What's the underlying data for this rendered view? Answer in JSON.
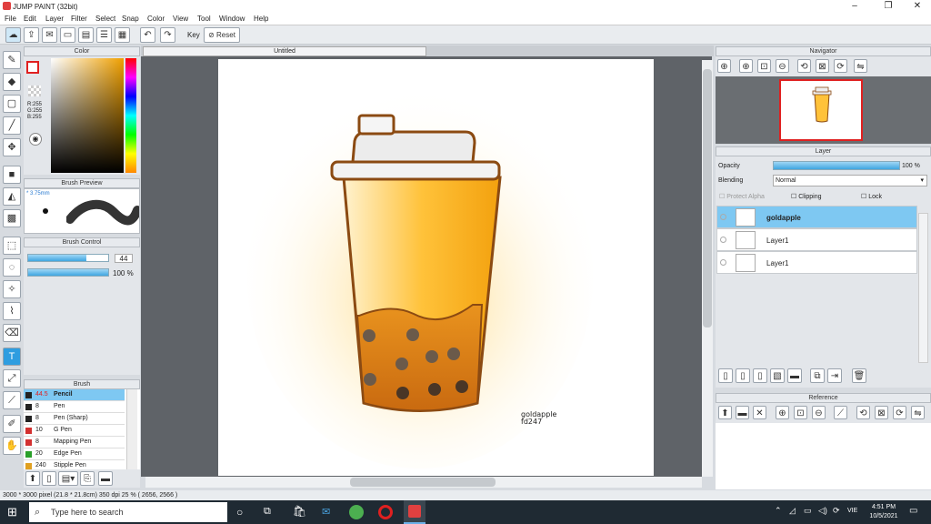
{
  "window": {
    "title": "JUMP PAINT (32bit)",
    "controls": {
      "minimize": "–",
      "maximize": "❐",
      "close": "✕"
    }
  },
  "menubar": [
    "File",
    "Edit",
    "Layer",
    "Filter",
    "Select",
    "Snap",
    "Color",
    "View",
    "Tool",
    "Window",
    "Help"
  ],
  "toolbar": {
    "key_label": "Key",
    "reset_label": "Reset"
  },
  "color_panel": {
    "title": "Color",
    "r": "R:255",
    "g": "G:255",
    "b": "B:255"
  },
  "brush_preview": {
    "title": "Brush Preview",
    "size": "* 3.75mm"
  },
  "brush_control": {
    "title": "Brush Control",
    "size_value": "44",
    "opacity_value": "100 %",
    "size_fraction": 0.73,
    "opacity_fraction": 1.0
  },
  "brush_panel": {
    "title": "Brush",
    "items": [
      {
        "size": "44.5",
        "name": "Pencil",
        "color": "#222222",
        "selected": true
      },
      {
        "size": "8",
        "name": "Pen",
        "color": "#222222",
        "selected": false
      },
      {
        "size": "8",
        "name": "Pen (Sharp)",
        "color": "#222222",
        "selected": false
      },
      {
        "size": "10",
        "name": "G Pen",
        "color": "#d33030",
        "selected": false
      },
      {
        "size": "8",
        "name": "Mapping Pen",
        "color": "#d33030",
        "selected": false
      },
      {
        "size": "20",
        "name": "Edge Pen",
        "color": "#2aa02a",
        "selected": false
      },
      {
        "size": "240",
        "name": "Stipple Pen",
        "color": "#e0a020",
        "selected": false
      }
    ]
  },
  "document": {
    "tab_title": "Untitled",
    "signature_line1": "goldapple",
    "signature_line2": "fd247"
  },
  "navigator": {
    "title": "Navigator"
  },
  "layer_panel": {
    "title": "Layer",
    "opacity_label": "Opacity",
    "opacity_value": "100 %",
    "blending_label": "Blending",
    "blending_value": "Normal",
    "protect_alpha": "Protect Alpha",
    "clipping": "Clipping",
    "lock": "Lock",
    "layers": [
      {
        "name": "goldapple",
        "selected": true
      },
      {
        "name": "Layer1",
        "selected": false
      },
      {
        "name": "Layer1",
        "selected": false
      }
    ]
  },
  "reference": {
    "title": "Reference"
  },
  "status": "3000 * 3000 pixel  (21.8 * 21.8cm)  350 dpi  25 %  ( 2656, 2566 )",
  "taskbar": {
    "search_placeholder": "Type here to search",
    "language": "VIE",
    "time": "4:51 PM",
    "date": "10/5/2021"
  },
  "colors": {
    "accent": "#4fb3e8",
    "selected_row": "#7ec8f2",
    "taskbar": "#1f2a33"
  }
}
